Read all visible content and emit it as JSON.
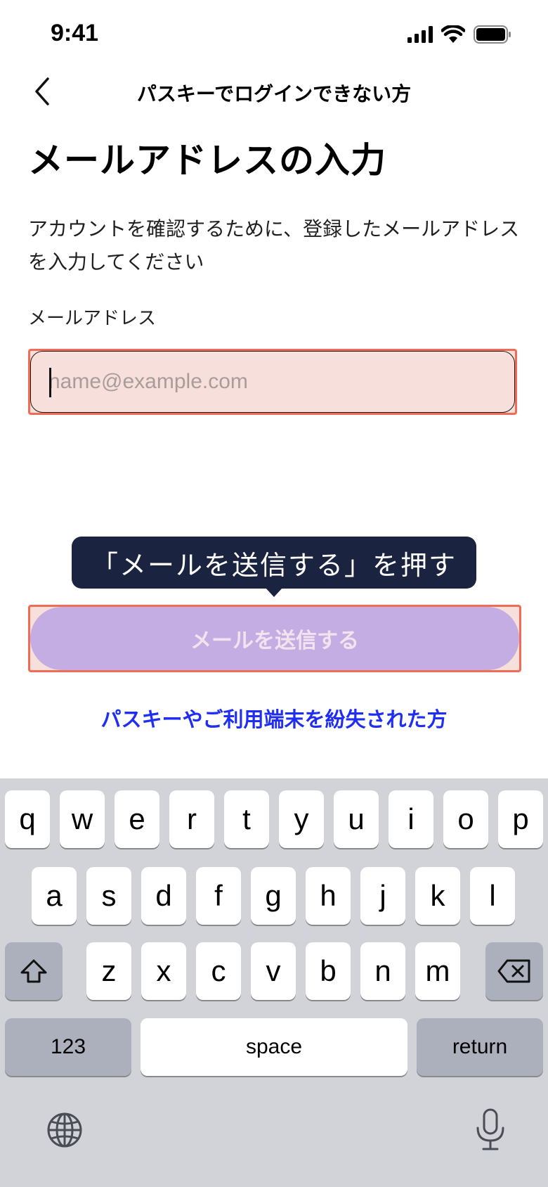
{
  "status_bar": {
    "time": "9:41",
    "signal_icon": "cellular-signal-icon",
    "wifi_icon": "wifi-icon",
    "battery_icon": "battery-icon"
  },
  "nav": {
    "back_icon": "chevron-left-icon",
    "title": "パスキーでログインできない方"
  },
  "page": {
    "heading": "メールアドレスの入力",
    "description": "アカウントを確認するために、登録したメールアドレスを入力してください",
    "field_label": "メールアドレス",
    "email_value": "",
    "email_placeholder": "name@example.com"
  },
  "tooltip": {
    "text": "「メールを送信する」を押す"
  },
  "send_button": {
    "label": "メールを送信する"
  },
  "lost_link": {
    "label": "パスキーやご利用端末を紛失された方"
  },
  "keyboard": {
    "row1": [
      "q",
      "w",
      "e",
      "r",
      "t",
      "y",
      "u",
      "i",
      "o",
      "p"
    ],
    "row2": [
      "a",
      "s",
      "d",
      "f",
      "g",
      "h",
      "j",
      "k",
      "l"
    ],
    "row3": [
      "z",
      "x",
      "c",
      "v",
      "b",
      "n",
      "m"
    ],
    "shift_icon": "shift-icon",
    "delete_icon": "delete-backspace-icon",
    "numbers_label": "123",
    "space_label": "space",
    "return_label": "return",
    "globe_icon": "globe-icon",
    "mic_icon": "microphone-icon"
  },
  "colors": {
    "accent_link": "#1f2ef2",
    "button_disabled": "#c3ade2",
    "highlight_border": "#ef6c57",
    "tooltip_bg": "#1a2340"
  }
}
